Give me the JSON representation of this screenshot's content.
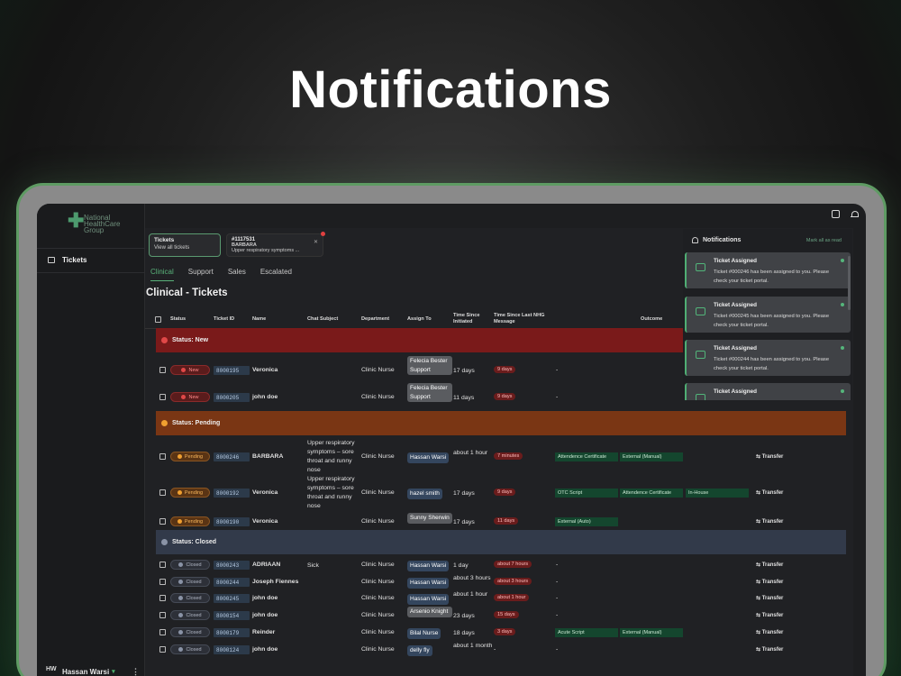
{
  "hero": {
    "title": "Notifications"
  },
  "logo": {
    "line1": "National",
    "line2": "HealthCare",
    "line3": "Group"
  },
  "sidebar": {
    "tickets_label": "Tickets"
  },
  "user": {
    "initials": "HW",
    "name": "Hassan Warsi"
  },
  "tabs": {
    "tickets": {
      "title": "Tickets",
      "subtitle": "View all tickets"
    },
    "chat": {
      "id": "#1117531",
      "name": "BARBARA",
      "preview": "Upper respiratory symptoms ..."
    }
  },
  "subtabs": [
    "Clinical",
    "Support",
    "Sales",
    "Escalated"
  ],
  "page_title": "Clinical - Tickets",
  "columns": {
    "status": "Status",
    "ticket_id": "Ticket ID",
    "name": "Name",
    "chat_subject": "Chat Subject",
    "department": "Department",
    "assign_to": "Assign To",
    "time_initiated": "Time Since Initiated",
    "time_last": "Time Since Last NHG Message",
    "outcome": "Outcome"
  },
  "groups": {
    "new": {
      "label": "Status: New",
      "color": "#7a1a1a"
    },
    "pending": {
      "label": "Status: Pending",
      "color": "#7a3614"
    },
    "closed": {
      "label": "Status: Closed",
      "color": "#323a4a"
    }
  },
  "rows": [
    {
      "status": "New",
      "id": "8000195",
      "name": "Veronica",
      "subject": "",
      "dept": "Clinic Nurse",
      "assign": "Felecia Bester Support",
      "initiated": "17 days",
      "last": "9 days",
      "outcomes": [],
      "dash": "-",
      "transfer": ""
    },
    {
      "status": "New",
      "id": "8000205",
      "name": "john doe",
      "subject": "",
      "dept": "Clinic Nurse",
      "assign": "Felecia Bester Support",
      "initiated": "11 days",
      "last": "9 days",
      "outcomes": [],
      "dash": "-",
      "transfer": ""
    },
    {
      "status": "Pending",
      "id": "8000246",
      "name": "BARBARA",
      "subject": "Upper respiratory symptoms – sore throat and runny nose",
      "dept": "Clinic Nurse",
      "assign": "Hassan Warsi",
      "initiated": "about 1 hour",
      "last": "7 minutes",
      "outcomes": [
        "Attendence Certificate",
        "External (Manual)"
      ],
      "dash": "",
      "transfer": "Transfer"
    },
    {
      "status": "Pending",
      "id": "8000192",
      "name": "Veronica",
      "subject": "Upper respiratory symptoms – sore throat and runny nose",
      "dept": "Clinic Nurse",
      "assign": "hazel smith",
      "initiated": "17 days",
      "last": "9 days",
      "outcomes": [
        "OTC Script",
        "Attendence Certificate",
        "In-House"
      ],
      "dash": "",
      "transfer": "Transfer"
    },
    {
      "status": "Pending",
      "id": "8000190",
      "name": "Veronica",
      "subject": "",
      "dept": "Clinic Nurse",
      "assign": "Sunny Sherwin",
      "initiated": "17 days",
      "last": "11 days",
      "outcomes": [
        "External (Auto)"
      ],
      "dash": "",
      "transfer": "Transfer"
    },
    {
      "status": "Closed",
      "id": "8000243",
      "name": "ADRIAAN",
      "subject": "Sick",
      "dept": "Clinic Nurse",
      "assign": "Hassan Warsi",
      "initiated": "1 day",
      "last": "about 7 hours",
      "outcomes": [],
      "dash": "-",
      "transfer": "Transfer"
    },
    {
      "status": "Closed",
      "id": "8000244",
      "name": "Joseph Fiennes",
      "subject": "",
      "dept": "Clinic Nurse",
      "assign": "Hassan Warsi",
      "initiated": "about 3 hours",
      "last": "about 3 hours",
      "outcomes": [],
      "dash": "-",
      "transfer": "Transfer"
    },
    {
      "status": "Closed",
      "id": "8000245",
      "name": "john doe",
      "subject": "",
      "dept": "Clinic Nurse",
      "assign": "Hassan Warsi",
      "initiated": "about 1 hour",
      "last": "about 1 hour",
      "outcomes": [],
      "dash": "-",
      "transfer": "Transfer"
    },
    {
      "status": "Closed",
      "id": "8000154",
      "name": "john doe",
      "subject": "",
      "dept": "Clinic Nurse",
      "assign": "Arsenio Knight",
      "initiated": "23 days",
      "last": "15 days",
      "outcomes": [],
      "dash": "-",
      "transfer": "Transfer"
    },
    {
      "status": "Closed",
      "id": "8000179",
      "name": "Reinder",
      "subject": "",
      "dept": "Clinic Nurse",
      "assign": "Bilal Nurse",
      "initiated": "18 days",
      "last": "3 days",
      "outcomes": [
        "Acute Script",
        "External (Manual)"
      ],
      "dash": "",
      "transfer": "Transfer"
    },
    {
      "status": "Closed",
      "id": "8000124",
      "name": "john doe",
      "subject": "",
      "dept": "Clinic Nurse",
      "assign": "delly fly",
      "initiated": "about 1 month",
      "last": "-",
      "outcomes": [],
      "dash": "-",
      "transfer": "Transfer"
    }
  ],
  "notifications": {
    "title": "Notifications",
    "mark_all": "Mark all as read",
    "items": [
      {
        "title": "Ticket Assigned",
        "body": "Ticket #000246 has been assigned to you. Please check your ticket portal."
      },
      {
        "title": "Ticket Assigned",
        "body": "Ticket #000245 has been assigned to you. Please check your ticket portal."
      },
      {
        "title": "Ticket Assigned",
        "body": "Ticket #000244 has been assigned to you. Please check your ticket portal."
      },
      {
        "title": "Ticket Assigned",
        "body": ""
      }
    ]
  }
}
